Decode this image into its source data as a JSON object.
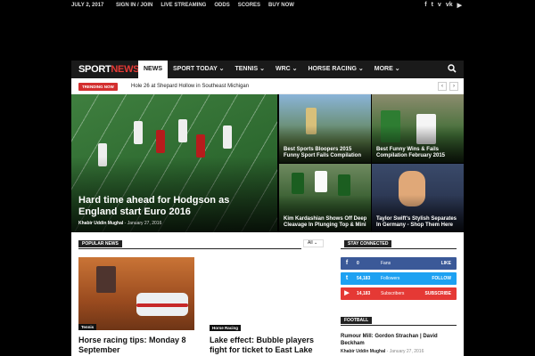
{
  "topbar": {
    "date": "JULY 2, 2017",
    "links": [
      "SIGN IN / JOIN",
      "LIVE STREAMING",
      "ODDS",
      "SCORES",
      "BUY NOW"
    ],
    "social_icons": [
      "facebook-icon",
      "twitter-icon",
      "vimeo-icon",
      "vk-icon",
      "youtube-icon"
    ]
  },
  "nav": {
    "logo_sport": "SPORT",
    "logo_news": "NEWS",
    "menu": [
      "NEWS",
      "SPORT TODAY ⌄",
      "TENNIS ⌄",
      "WRC ⌄",
      "HORSE RACING ⌄",
      "MORE ⌄"
    ],
    "search_icon": "search-icon"
  },
  "trending": {
    "badge": "TRENDING NOW",
    "text": "Hole 26 at Shepard Hollow in Southeast Michigan"
  },
  "featured": {
    "big_title": "Hard time ahead for Hodgson as England start Euro 2016",
    "big_author": "Khabir Uddin Mughal",
    "big_date": "- January 27, 2016",
    "tiles": [
      "Best Sports Bloopers 2015 Funny Sport Fails Compilation",
      "Best Funny Wins & Fails Compilation February 2015",
      "Kim Kardashian Shows Off Deep Cleavage In Plunging Top & Mini",
      "Taylor Swift's Stylish Separates In Germany - Shop Them Here"
    ]
  },
  "popular": {
    "title": "POPULAR NEWS",
    "filter": "All ⌄",
    "tag1": "Tennis",
    "tag2": "Horse Racing",
    "title1": "Horse racing tips: Monday 8 September",
    "title2": "Lake effect: Bubble players fight for ticket to East Lake"
  },
  "sidebar": {
    "title": "STAY CONNECTED",
    "rows": [
      {
        "icon": "f",
        "count": "0",
        "label": "Fans",
        "action": "LIKE",
        "color": "#3b5998"
      },
      {
        "icon": "t",
        "count": "54,183",
        "label": "Followers",
        "action": "FOLLOW",
        "color": "#1da1f2"
      },
      {
        "icon": "▶",
        "count": "14,183",
        "label": "Subscribers",
        "action": "SUBSCRIBE",
        "color": "#e53935"
      }
    ],
    "football_title": "FOOTBALL",
    "rumour": "Rumour Mill: Gordon Strachan | David Beckham",
    "rumour_author": "Khabir Uddin Mughal",
    "rumour_date": "- January 27, 2016"
  }
}
